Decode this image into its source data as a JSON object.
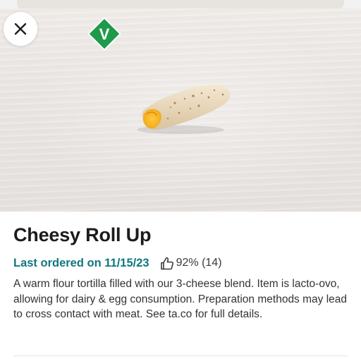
{
  "item": {
    "name": "Cheesy Roll Up",
    "last_ordered": "Last ordered on 11/15/23",
    "rating": "92% (14)",
    "description": "A warm flour tortilla filled with our 3-cheese blend. Item is lacto-ovo, allowing for dairy & egg consumption. Preparation methods may lead to cross contact with meat. See ta.co for full details."
  },
  "badge": {
    "letter": "V",
    "color": "#1f9a4a"
  },
  "colors": {
    "accent": "#10777f",
    "title": "#1c1c1c",
    "body": "#333333"
  },
  "icons": {
    "close": "close-icon",
    "rating": "thumbs-up-icon",
    "badge": "vegetarian-badge-icon"
  }
}
